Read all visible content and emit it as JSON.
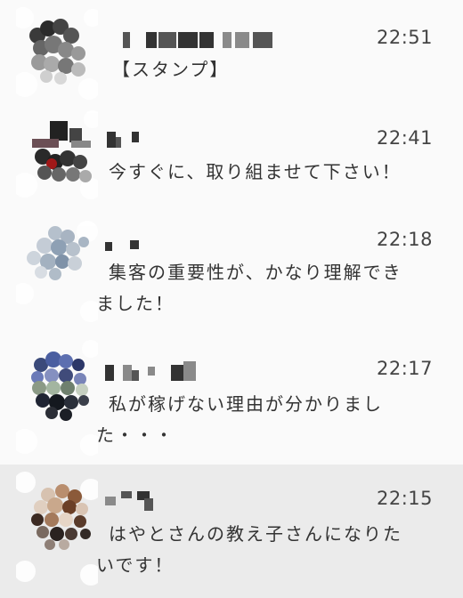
{
  "colors": {
    "row_bg": "#fafafa",
    "active_bg": "#ebebeb",
    "divider": "#dedede",
    "text": "#333333"
  },
  "messages": [
    {
      "time": "22:51",
      "text": "【スタンプ】"
    },
    {
      "time": "22:41",
      "text": "今すぐに、取り組ませて下さい！"
    },
    {
      "time": "22:18",
      "text": "集客の重要性が、かなり理解できました！"
    },
    {
      "time": "22:17",
      "text": "私が稼げない理由が分かりました・・・"
    },
    {
      "time": "22:15",
      "text": "はやとさんの教え子さんになりたいです！"
    }
  ]
}
